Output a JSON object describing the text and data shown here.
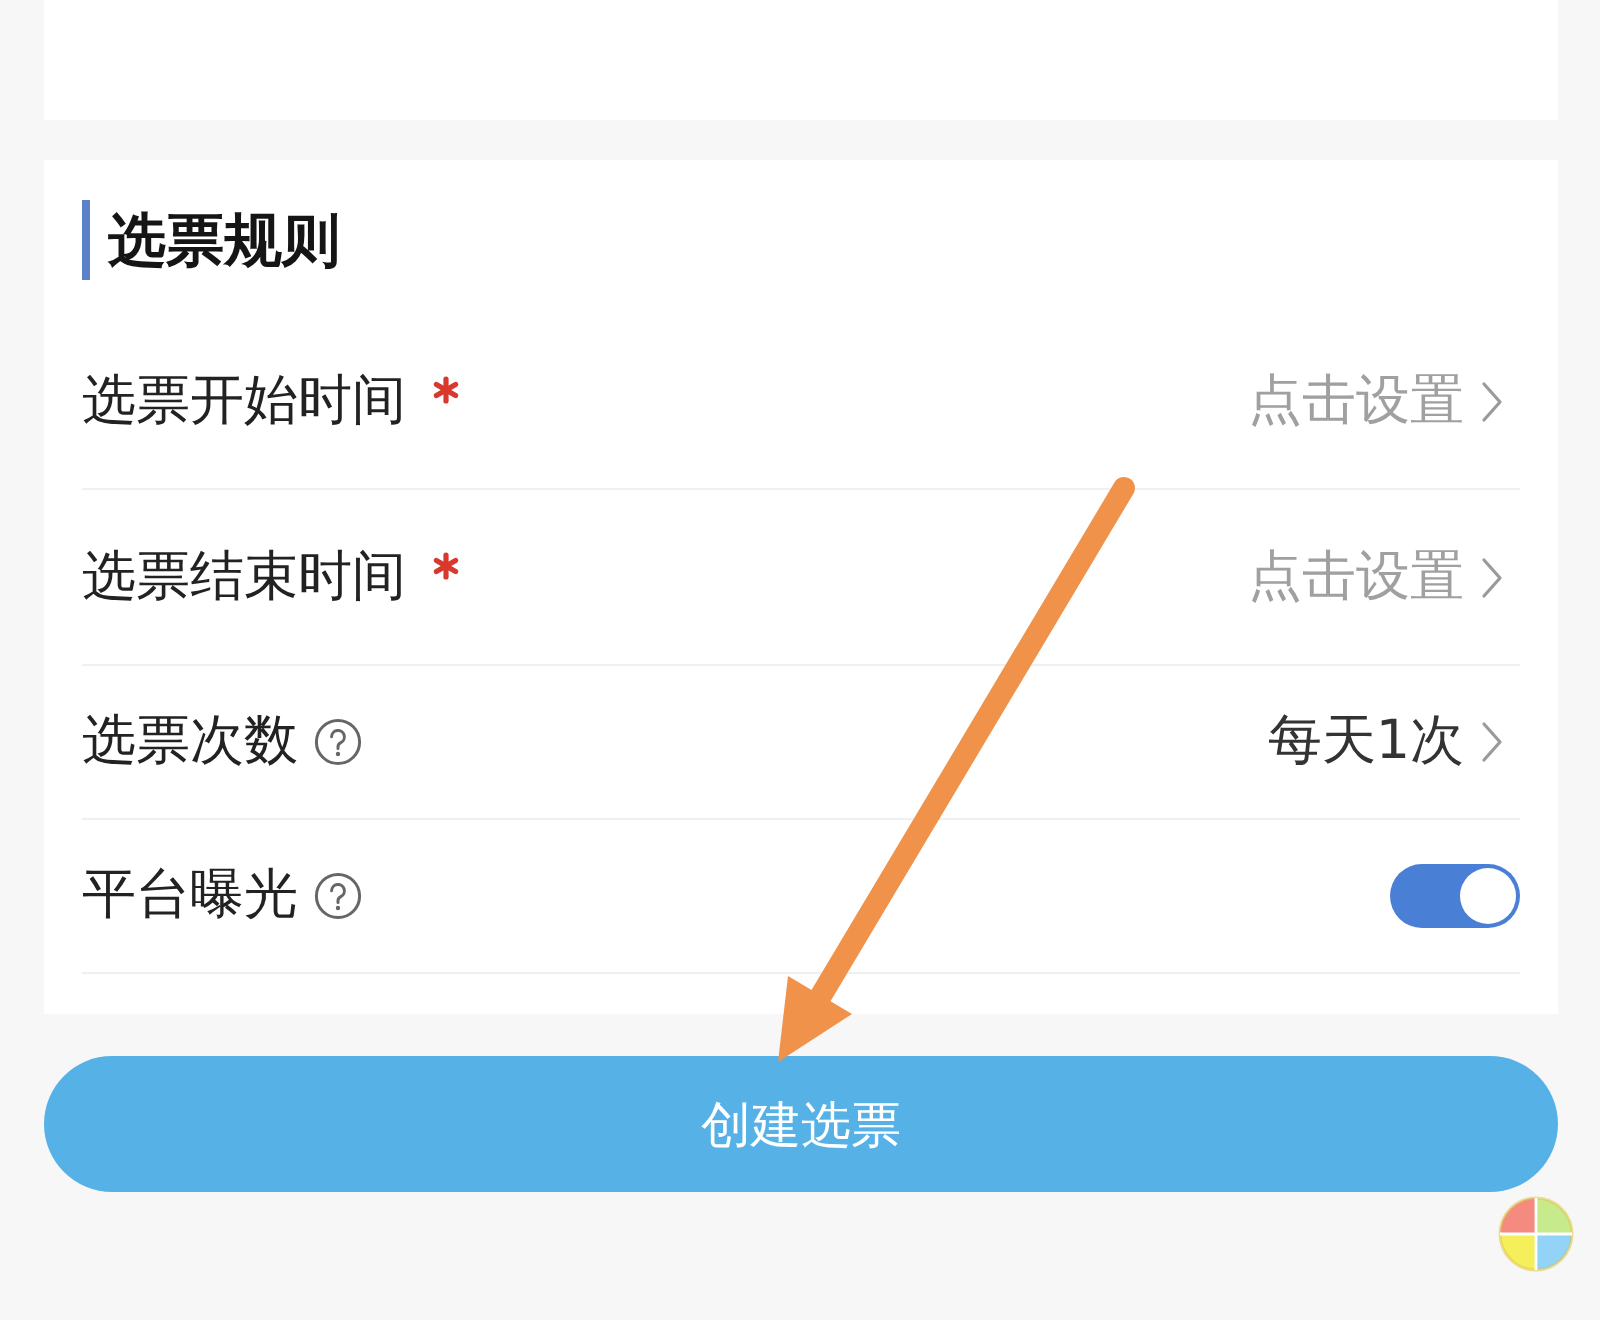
{
  "section": {
    "title": "选票规则",
    "rows": [
      {
        "kind": "select",
        "label": "选票开始时间",
        "required": true,
        "help": false,
        "placeholder": "点击设置"
      },
      {
        "kind": "select",
        "label": "选票结束时间",
        "required": true,
        "help": false,
        "placeholder": "点击设置"
      },
      {
        "kind": "select",
        "label": "选票次数",
        "required": false,
        "help": true,
        "value": "每天1次"
      },
      {
        "kind": "toggle",
        "label": "平台曝光",
        "required": false,
        "help": true,
        "on": true
      }
    ]
  },
  "submit_button": {
    "label": "创建选票"
  }
}
